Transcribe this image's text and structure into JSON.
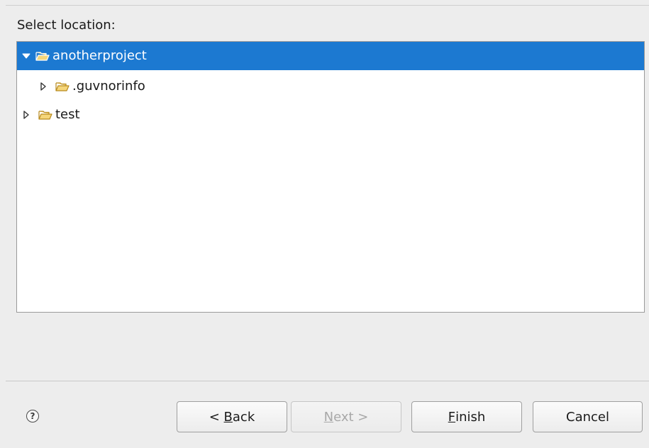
{
  "dialog": {
    "section_label": "Select location:",
    "tree": [
      {
        "label": "anotherproject",
        "expanded": true,
        "selected": true,
        "depth": 0,
        "icon": "open-folder-icon"
      },
      {
        "label": ".guvnorinfo",
        "expanded": false,
        "selected": false,
        "depth": 1,
        "icon": "open-folder-icon"
      },
      {
        "label": "test",
        "expanded": false,
        "selected": false,
        "depth": 0,
        "icon": "open-folder-icon"
      }
    ],
    "buttons": {
      "back": {
        "prefix": "< ",
        "mnemonic": "B",
        "suffix": "ack",
        "enabled": true
      },
      "next": {
        "prefix": "",
        "mnemonic": "N",
        "suffix": "ext >",
        "enabled": false
      },
      "finish": {
        "prefix": "",
        "mnemonic": "F",
        "suffix": "inish",
        "enabled": true
      },
      "cancel": {
        "label": "Cancel",
        "enabled": true
      }
    },
    "help_glyph": "?"
  },
  "colors": {
    "selection": "#1c79d1",
    "folder_fill": "#f5d67a",
    "folder_stroke": "#b88a1e",
    "background": "#ededed"
  }
}
